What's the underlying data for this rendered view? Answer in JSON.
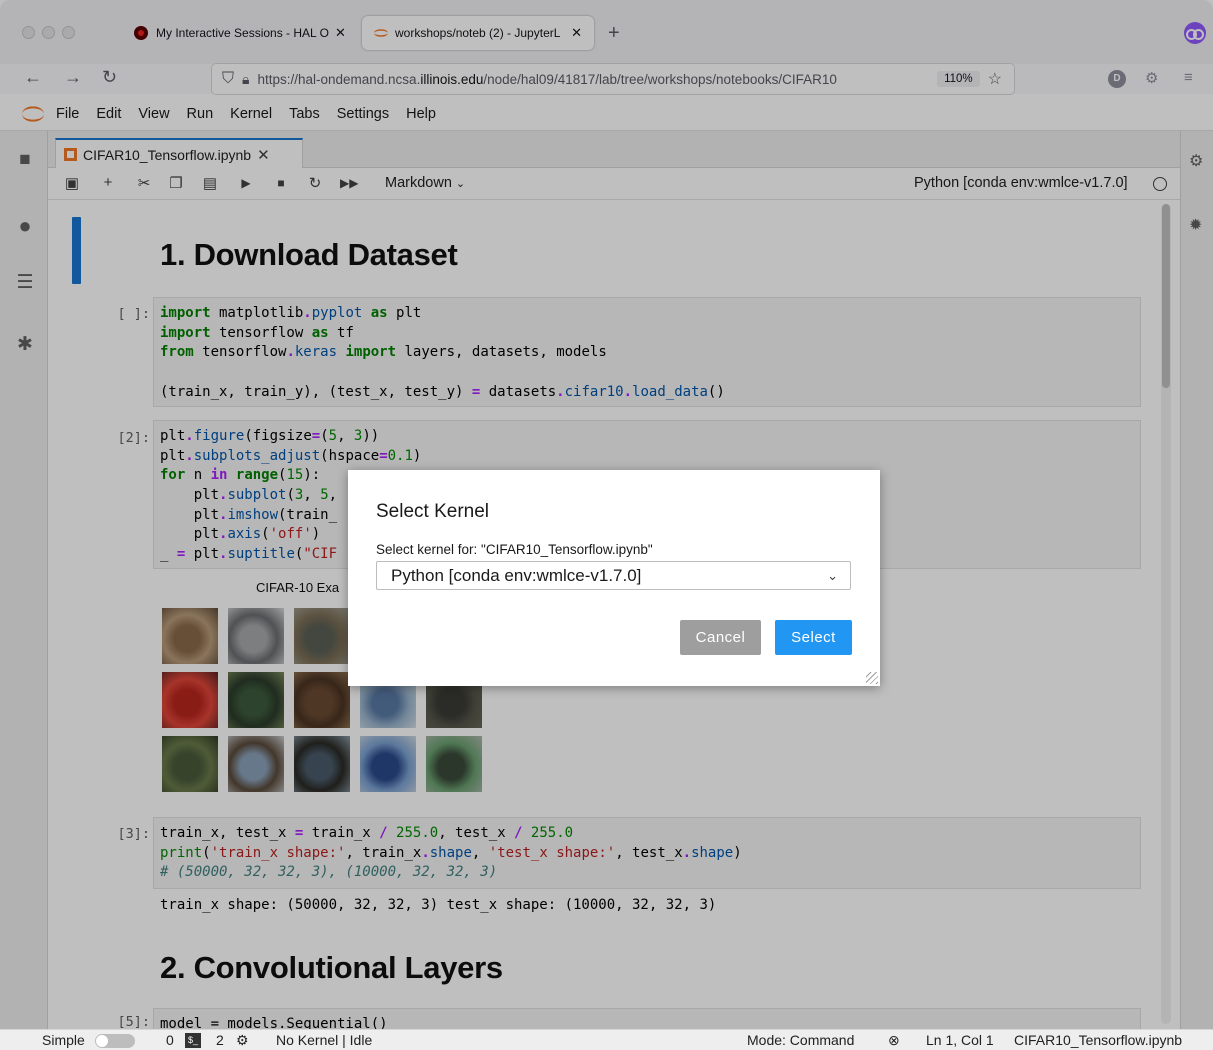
{
  "browser": {
    "tabs": [
      {
        "title": "My Interactive Sessions - HAL O",
        "active": false
      },
      {
        "title": "workshops/noteb (2) - JupyterL",
        "active": true
      }
    ],
    "new_tab": "+",
    "url_prefix": "https://hal-ondemand.ncsa.",
    "url_domain": "illinois.edu",
    "url_rest": "/node/hal09/41817/lab/tree/workshops/notebooks/CIFAR10",
    "zoom": "110%",
    "profile_initial": "D"
  },
  "menu": [
    "File",
    "Edit",
    "View",
    "Run",
    "Kernel",
    "Tabs",
    "Settings",
    "Help"
  ],
  "doc_tab": {
    "title": "CIFAR10_Tensorflow.ipynb"
  },
  "toolbar": {
    "cell_type": "Markdown",
    "kernel": "Python [conda env:wmlce-v1.7.0]"
  },
  "notebook": {
    "heading1": "1. Download Dataset",
    "heading2": "2. Convolutional Layers",
    "prompts": {
      "c1": "[ ]:",
      "c2": "[2]:",
      "c3": "[3]:",
      "c4": "[5]:"
    },
    "cell1": [
      "import matplotlib.pyplot as plt",
      "import tensorflow as tf",
      "from tensorflow.keras import layers, datasets, models",
      "",
      "(train_x, train_y), (test_x, test_y) = datasets.cifar10.load_data()"
    ],
    "cell2": [
      "plt.figure(figsize=(5, 3))",
      "plt.subplots_adjust(hspace=0.1)",
      "for n in range(15):",
      "    plt.subplot(3, 5,",
      "    plt.imshow(train_",
      "    plt.axis('off')",
      "_ = plt.suptitle(\"CIF"
    ],
    "figure_title": "CIFAR-10 Exa",
    "cell3": [
      "train_x, test_x = train_x / 255.0, test_x / 255.0",
      "print('train_x shape:', train_x.shape, 'test_x shape:', test_x.shape)",
      "# (50000, 32, 32, 3), (10000, 32, 32, 3)"
    ],
    "cell3_output": "train_x shape: (50000, 32, 32, 3) test_x shape: (10000, 32, 32, 3)",
    "cell4": "model = models.Sequential()"
  },
  "dialog": {
    "title": "Select Kernel",
    "label": "Select kernel for: \"CIFAR10_Tensorflow.ipynb\"",
    "selected": "Python [conda env:wmlce-v1.7.0]",
    "cancel": "Cancel",
    "select": "Select"
  },
  "status": {
    "simple": "Simple",
    "terminals": "0",
    "kernels": "2",
    "kernel_status": "No Kernel | Idle",
    "mode": "Mode: Command",
    "position": "Ln 1, Col 1",
    "file": "CIFAR10_Tensorflow.ipynb"
  },
  "colors": {
    "accent": "#1976d2",
    "select_button": "#2196f3",
    "cancel_button": "#9e9e9e",
    "jupyter_orange": "#f37726"
  }
}
